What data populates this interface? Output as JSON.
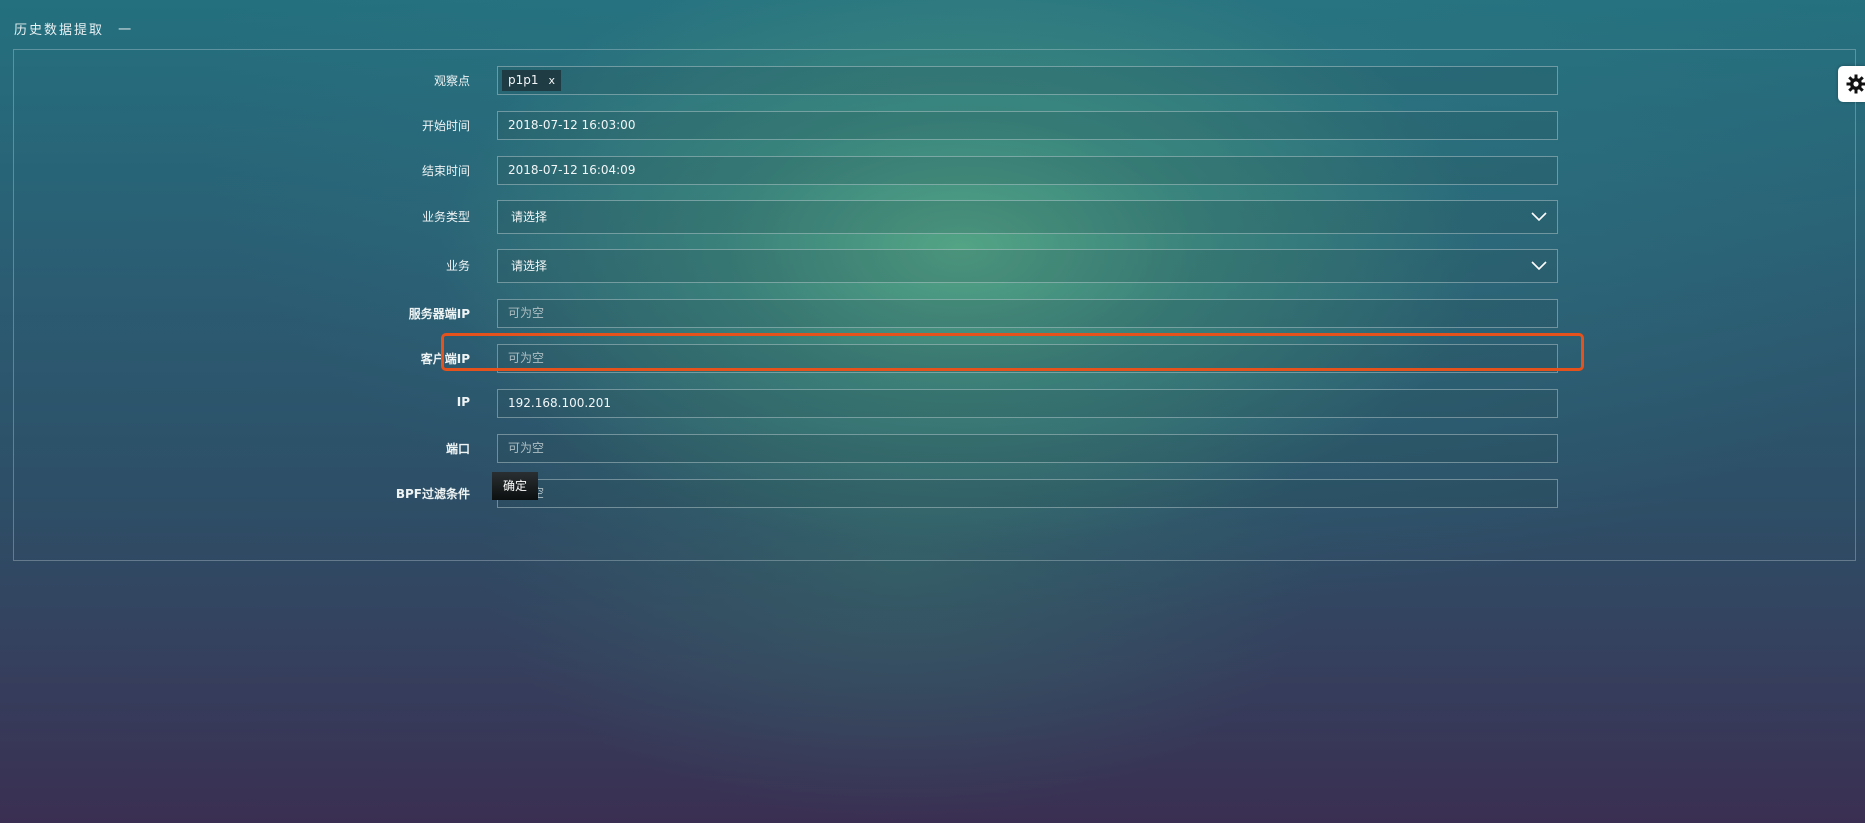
{
  "header": {
    "title": "历史数据提取",
    "collapse_glyph": "一"
  },
  "form": {
    "observation_point": {
      "label": "观察点",
      "tag": "p1p1",
      "tag_remove": "x"
    },
    "start_time": {
      "label": "开始时间",
      "value": "2018-07-12 16:03:00"
    },
    "end_time": {
      "label": "结束时间",
      "value": "2018-07-12 16:04:09"
    },
    "business_type": {
      "label": "业务类型",
      "selected": "请选择"
    },
    "business": {
      "label": "业务",
      "selected": "请选择"
    },
    "server_ip": {
      "label": "服务器端IP",
      "placeholder": "可为空"
    },
    "client_ip": {
      "label": "客户端IP",
      "placeholder": "可为空"
    },
    "ip": {
      "label": "IP",
      "value": "192.168.100.201"
    },
    "port": {
      "label": "端口",
      "placeholder": "可为空"
    },
    "bpf_filter": {
      "label": "BPF过滤条件",
      "placeholder": "可为空"
    },
    "confirm_label": "确定"
  },
  "icons": {
    "settings": "gear-icon",
    "dropdown": "chevron-down-icon"
  },
  "colors": {
    "highlight": "#e5521c",
    "confirm_button": "#111111"
  }
}
